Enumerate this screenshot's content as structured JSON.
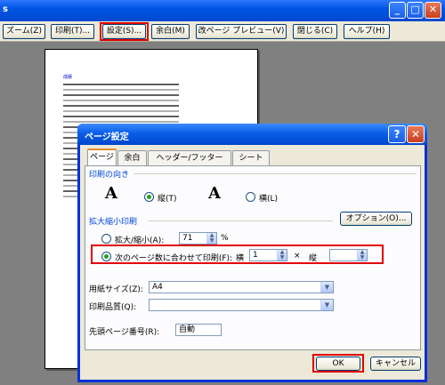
{
  "toolbar": {
    "zoom": "ズーム(Z)",
    "print": "印刷(T)...",
    "setup": "設定(S)...",
    "margins": "余白(M)",
    "page_break_preview": "改ページ プレビュー(V)",
    "close": "閉じる(C)",
    "help": "ヘルプ(H)"
  },
  "window": {
    "title_fragment": "s"
  },
  "preview": {
    "sheet_title": "成績"
  },
  "dialog": {
    "title": "ページ設定",
    "tabs": [
      "ページ",
      "余白",
      "ヘッダー/フッター",
      "シート"
    ],
    "orientation": {
      "heading": "印刷の向き",
      "portrait": "縦(T)",
      "landscape": "横(L)",
      "portrait_icon_glyph": "A",
      "landscape_icon_glyph": "A"
    },
    "scaling": {
      "heading": "拡大縮小印刷",
      "adjust_label": "拡大/縮小(A):",
      "adjust_value": "71",
      "percent": "%",
      "fit_label": "次のページ数に合わせて印刷(F):",
      "wide_label": "横",
      "wide_value": "1",
      "times": "×",
      "tall_label": "縦",
      "tall_value": ""
    },
    "options_button": "オプション(O)...",
    "paper_size_label": "用紙サイズ(Z):",
    "paper_size_value": "A4",
    "print_quality_label": "印刷品質(Q):",
    "print_quality_value": "",
    "first_page_label": "先頭ページ番号(R):",
    "first_page_value": "自動",
    "ok": "OK",
    "cancel": "キャンセル",
    "help_glyph": "?",
    "close_glyph": "✕"
  },
  "colors": {
    "highlight": "#e00000",
    "accent": "#0046d5"
  }
}
